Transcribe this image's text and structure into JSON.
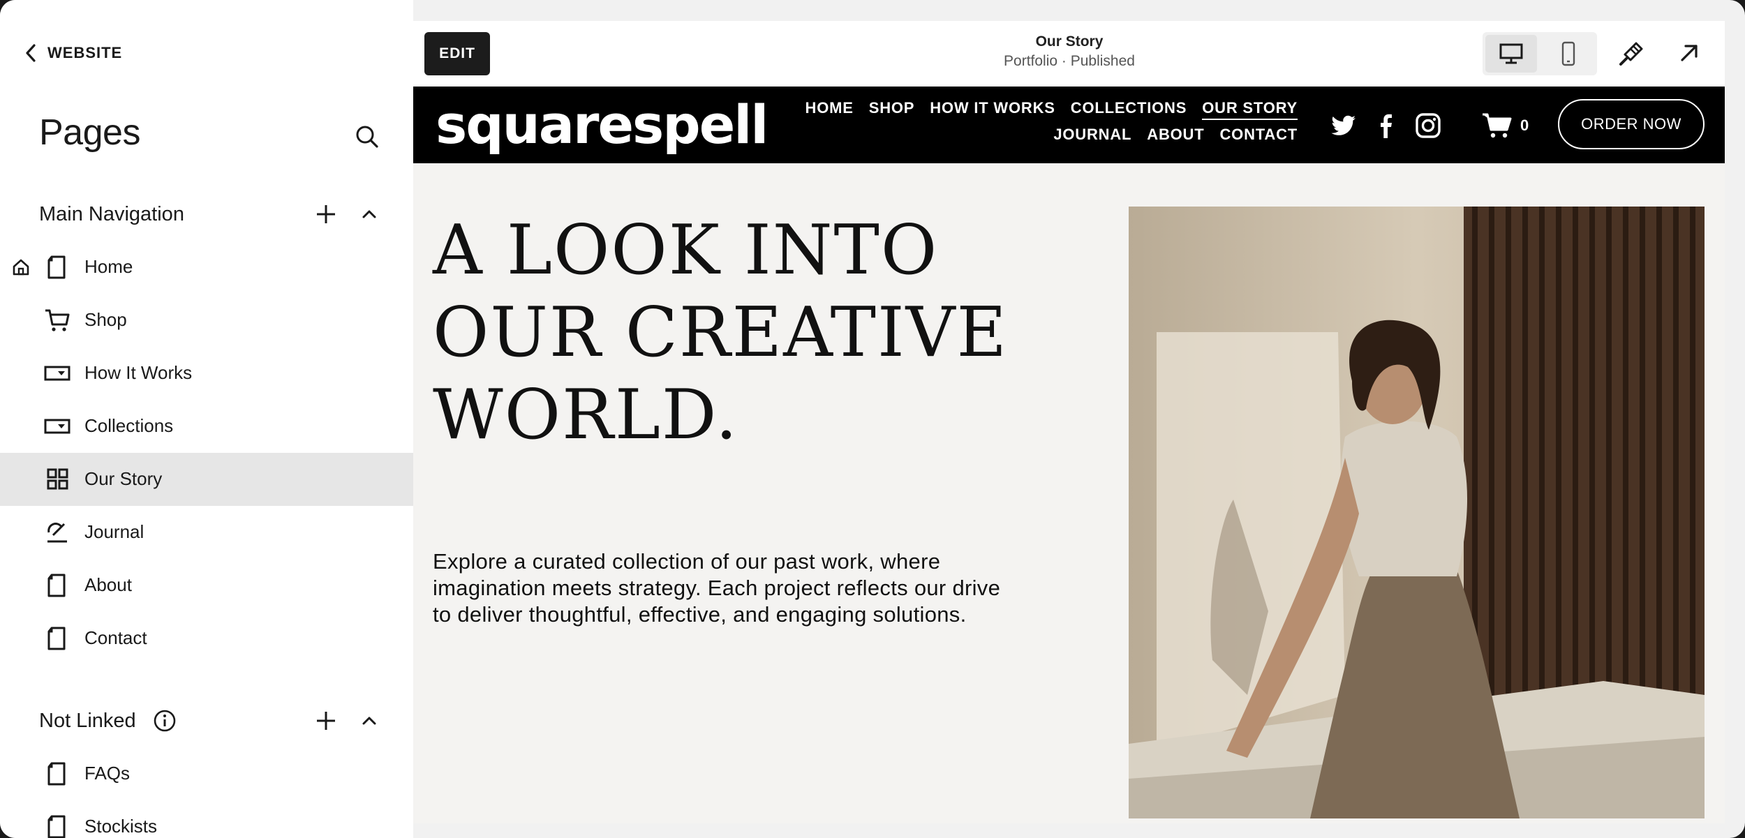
{
  "sidebar": {
    "back_label": "WEBSITE",
    "title": "Pages",
    "main_nav": {
      "label": "Main Navigation",
      "items": [
        {
          "label": "Home",
          "icon": "page-icon",
          "is_home": true
        },
        {
          "label": "Shop",
          "icon": "cart-icon"
        },
        {
          "label": "How It Works",
          "icon": "folder-dropdown-icon"
        },
        {
          "label": "Collections",
          "icon": "folder-dropdown-icon"
        },
        {
          "label": "Our Story",
          "icon": "grid-icon",
          "active": true
        },
        {
          "label": "Journal",
          "icon": "blog-pen-icon"
        },
        {
          "label": "About",
          "icon": "page-icon"
        },
        {
          "label": "Contact",
          "icon": "page-icon"
        }
      ]
    },
    "not_linked": {
      "label": "Not Linked",
      "items": [
        {
          "label": "FAQs",
          "icon": "page-icon"
        },
        {
          "label": "Stockists",
          "icon": "page-icon"
        }
      ]
    }
  },
  "toolbar": {
    "edit_label": "EDIT",
    "page_title": "Our Story",
    "page_status": "Portfolio · Published"
  },
  "site": {
    "logo": "squarespell",
    "nav_row1": [
      "HOME",
      "SHOP",
      "HOW IT WORKS",
      "COLLECTIONS",
      "OUR STORY"
    ],
    "nav_row2": [
      "JOURNAL",
      "ABOUT",
      "CONTACT"
    ],
    "current_nav": "OUR STORY",
    "cart_count": "0",
    "cta_label": "ORDER NOW",
    "hero_title": "A LOOK INTO OUR CREATIVE WORLD.",
    "hero_body": "Explore a curated collection of our past work, where imagination meets strategy. Each project reflects our drive to deliver thoughtful, effective, and engaging solutions."
  },
  "colors": {
    "header_bg": "#000000",
    "active_row": "#e6e6e6",
    "preview_bg": "#f4f3f1"
  }
}
